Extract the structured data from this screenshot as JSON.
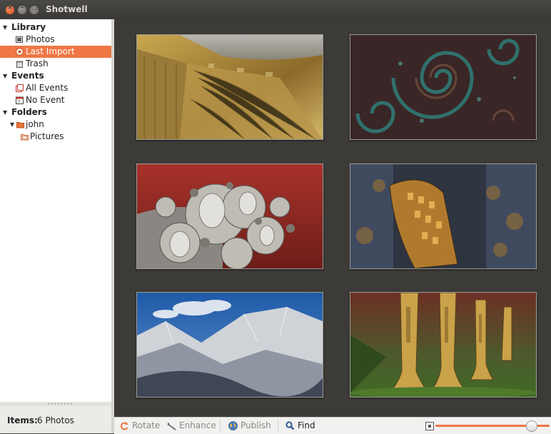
{
  "window": {
    "title": "Shotwell"
  },
  "sidebar": {
    "library": {
      "label": "Library",
      "items": [
        "Photos",
        "Last Import",
        "Trash"
      ],
      "selected": "Last Import"
    },
    "events": {
      "label": "Events",
      "items": [
        "All Events",
        "No Event"
      ]
    },
    "folders": {
      "label": "Folders",
      "items": [
        "john",
        "Pictures"
      ]
    }
  },
  "status": {
    "label": "Items:",
    "value": "6 Photos"
  },
  "toolbar": {
    "rotate": "Rotate",
    "enhance": "Enhance",
    "publish": "Publish",
    "find": "Find",
    "zoom_level": 0.87
  },
  "colors": {
    "selection": "#f07746",
    "viewer_bg": "#3c3b37",
    "titlebar": "#3c3b37"
  },
  "photos": [
    {
      "name": "fractal-golden-corridor"
    },
    {
      "name": "fractal-teal-spirals"
    },
    {
      "name": "fractal-mandelbulb-red"
    },
    {
      "name": "fractal-golden-tower"
    },
    {
      "name": "fractal-silver-mountains"
    },
    {
      "name": "fractal-forest-trunks"
    }
  ]
}
